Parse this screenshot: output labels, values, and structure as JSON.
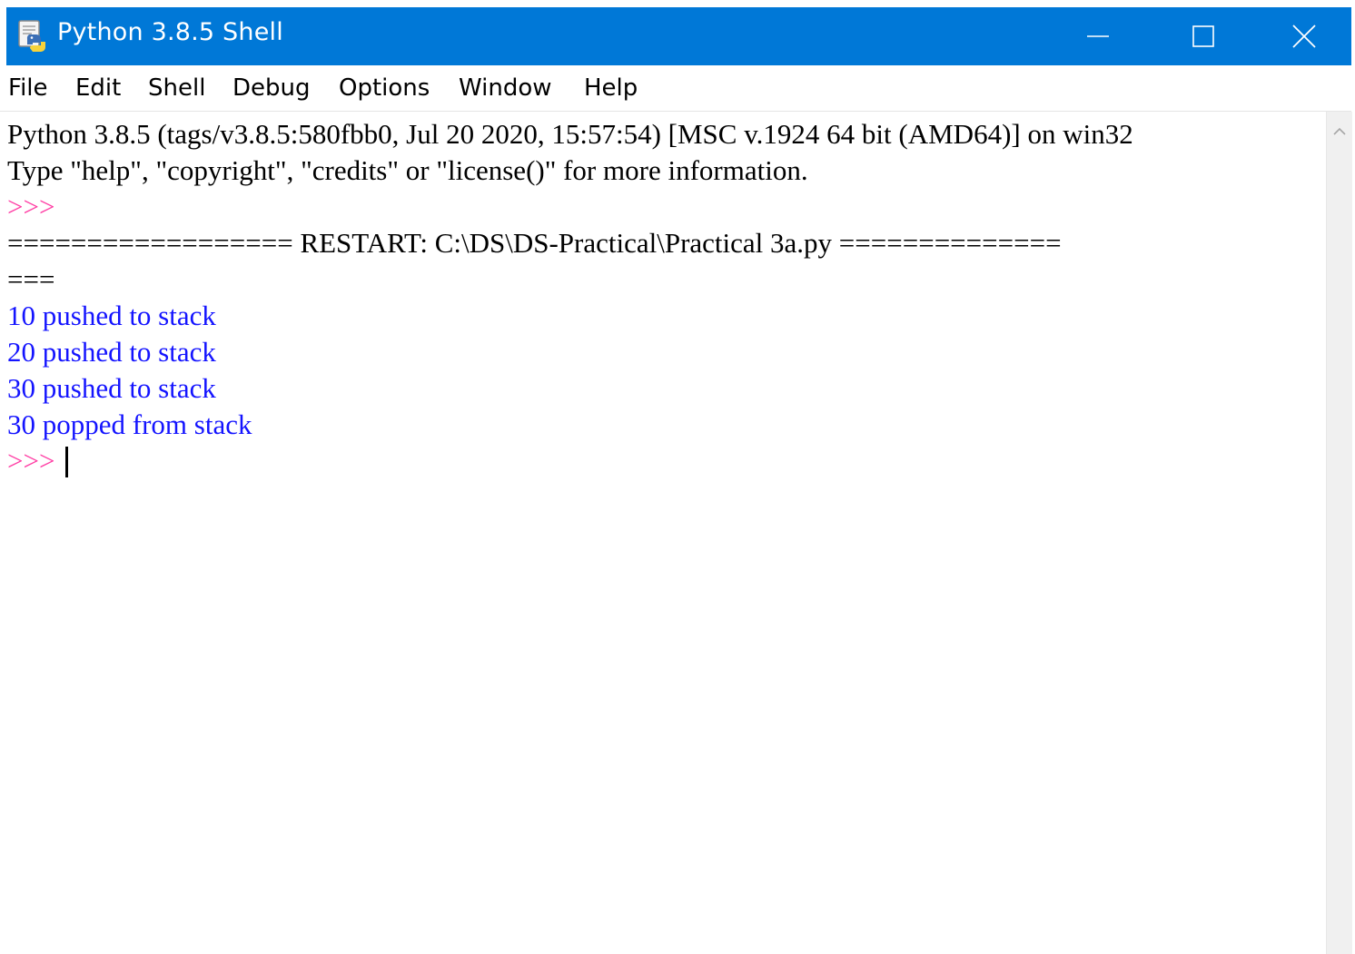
{
  "window": {
    "title": "Python 3.8.5 Shell",
    "app_icon": "python-idle-icon",
    "controls": {
      "minimize_icon": "minimize-icon",
      "maximize_icon": "maximize-icon",
      "close_icon": "close-icon"
    },
    "title_bar_color": "#0078d7"
  },
  "menu": {
    "items": [
      {
        "label": "File"
      },
      {
        "label": "Edit"
      },
      {
        "label": "Shell"
      },
      {
        "label": "Debug"
      },
      {
        "label": "Options"
      },
      {
        "label": "Window"
      },
      {
        "label": "Help"
      }
    ]
  },
  "shell": {
    "banner_line1": "Python 3.8.5 (tags/v3.8.5:580fbb0, Jul 20 2020, 15:57:54) [MSC v.1924 64 bit (AMD64)] on win32",
    "banner_line2": "Type \"help\", \"copyright\", \"credits\" or \"license()\" for more information.",
    "prompt1": ">>> ",
    "restart_line": "================== RESTART: C:\\DS\\DS-Practical\\Practical 3a.py ==============",
    "restart_wrap": "===",
    "output": [
      "10 pushed to stack",
      "20 pushed to stack",
      "30 pushed to stack",
      "30 popped from stack"
    ],
    "prompt2": ">>> ",
    "prompt_color": "#ff3fa5",
    "output_color": "#1414ff"
  },
  "scrollbar": {
    "up_arrow_icon": "scroll-up-arrow-icon"
  }
}
